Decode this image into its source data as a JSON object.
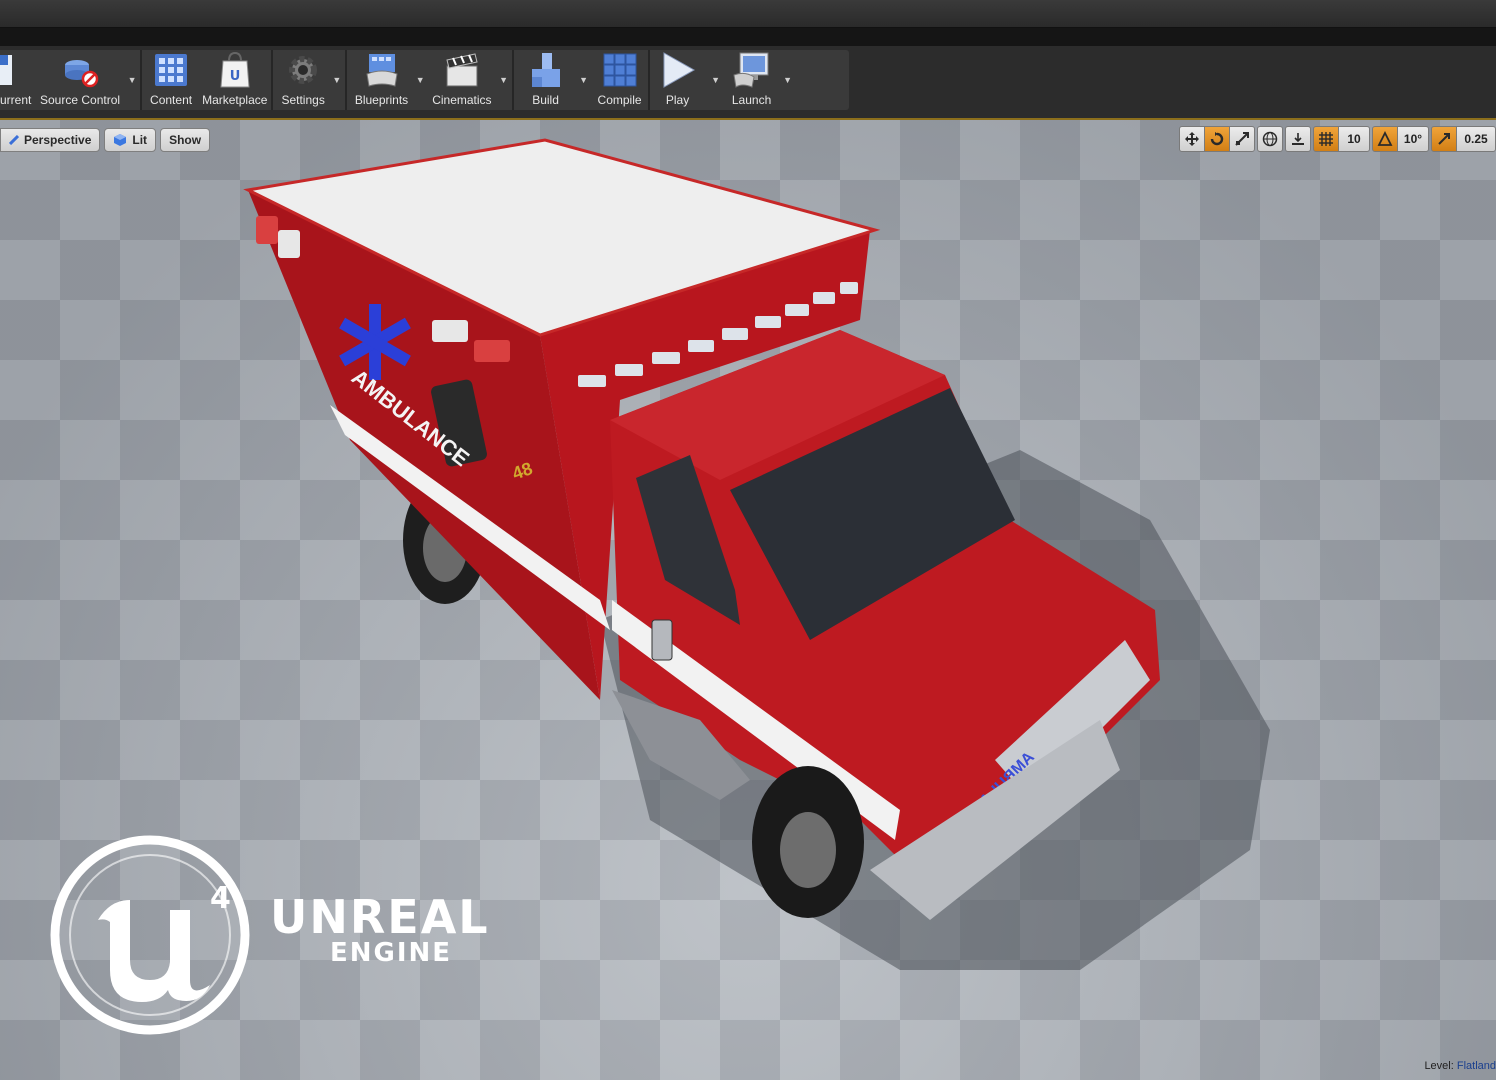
{
  "toolbar": {
    "items": [
      {
        "label": "urrent",
        "icon": "save-icon",
        "dropdown": false
      },
      {
        "label": "Source Control",
        "icon": "source-control-icon",
        "dropdown": true
      },
      {
        "label": "Content",
        "icon": "content-grid-icon",
        "dropdown": false
      },
      {
        "label": "Marketplace",
        "icon": "marketplace-bag-icon",
        "dropdown": false
      },
      {
        "label": "Settings",
        "icon": "gear-icon",
        "dropdown": true
      },
      {
        "label": "Blueprints",
        "icon": "blueprint-controller-icon",
        "dropdown": true
      },
      {
        "label": "Cinematics",
        "icon": "clapperboard-icon",
        "dropdown": true
      },
      {
        "label": "Build",
        "icon": "build-blocks-icon",
        "dropdown": true
      },
      {
        "label": "Compile",
        "icon": "compile-cubes-icon",
        "dropdown": false
      },
      {
        "label": "Play",
        "icon": "play-icon",
        "dropdown": true
      },
      {
        "label": "Launch",
        "icon": "launch-monitor-icon",
        "dropdown": true
      }
    ]
  },
  "viewport": {
    "perspective_label": "Perspective",
    "lit_label": "Lit",
    "show_label": "Show",
    "grid_snap_value": "10",
    "rotation_snap_value": "10°",
    "scale_snap_value": "0.25",
    "level_label": "Level:",
    "level_name": "Flatland"
  },
  "scene": {
    "logo_word1": "UNREAL",
    "logo_word2": "ENGINE",
    "logo_superscript": "4",
    "side_text": "AMBULANCE",
    "hood_text": "AMBULANCE",
    "unit_number": "48"
  },
  "colors": {
    "ambulance_red": "#b3161d",
    "stripe_white": "#f2f2f2",
    "active_tool_orange": "#e08d22",
    "selection_outline": "#8c6f1c"
  }
}
